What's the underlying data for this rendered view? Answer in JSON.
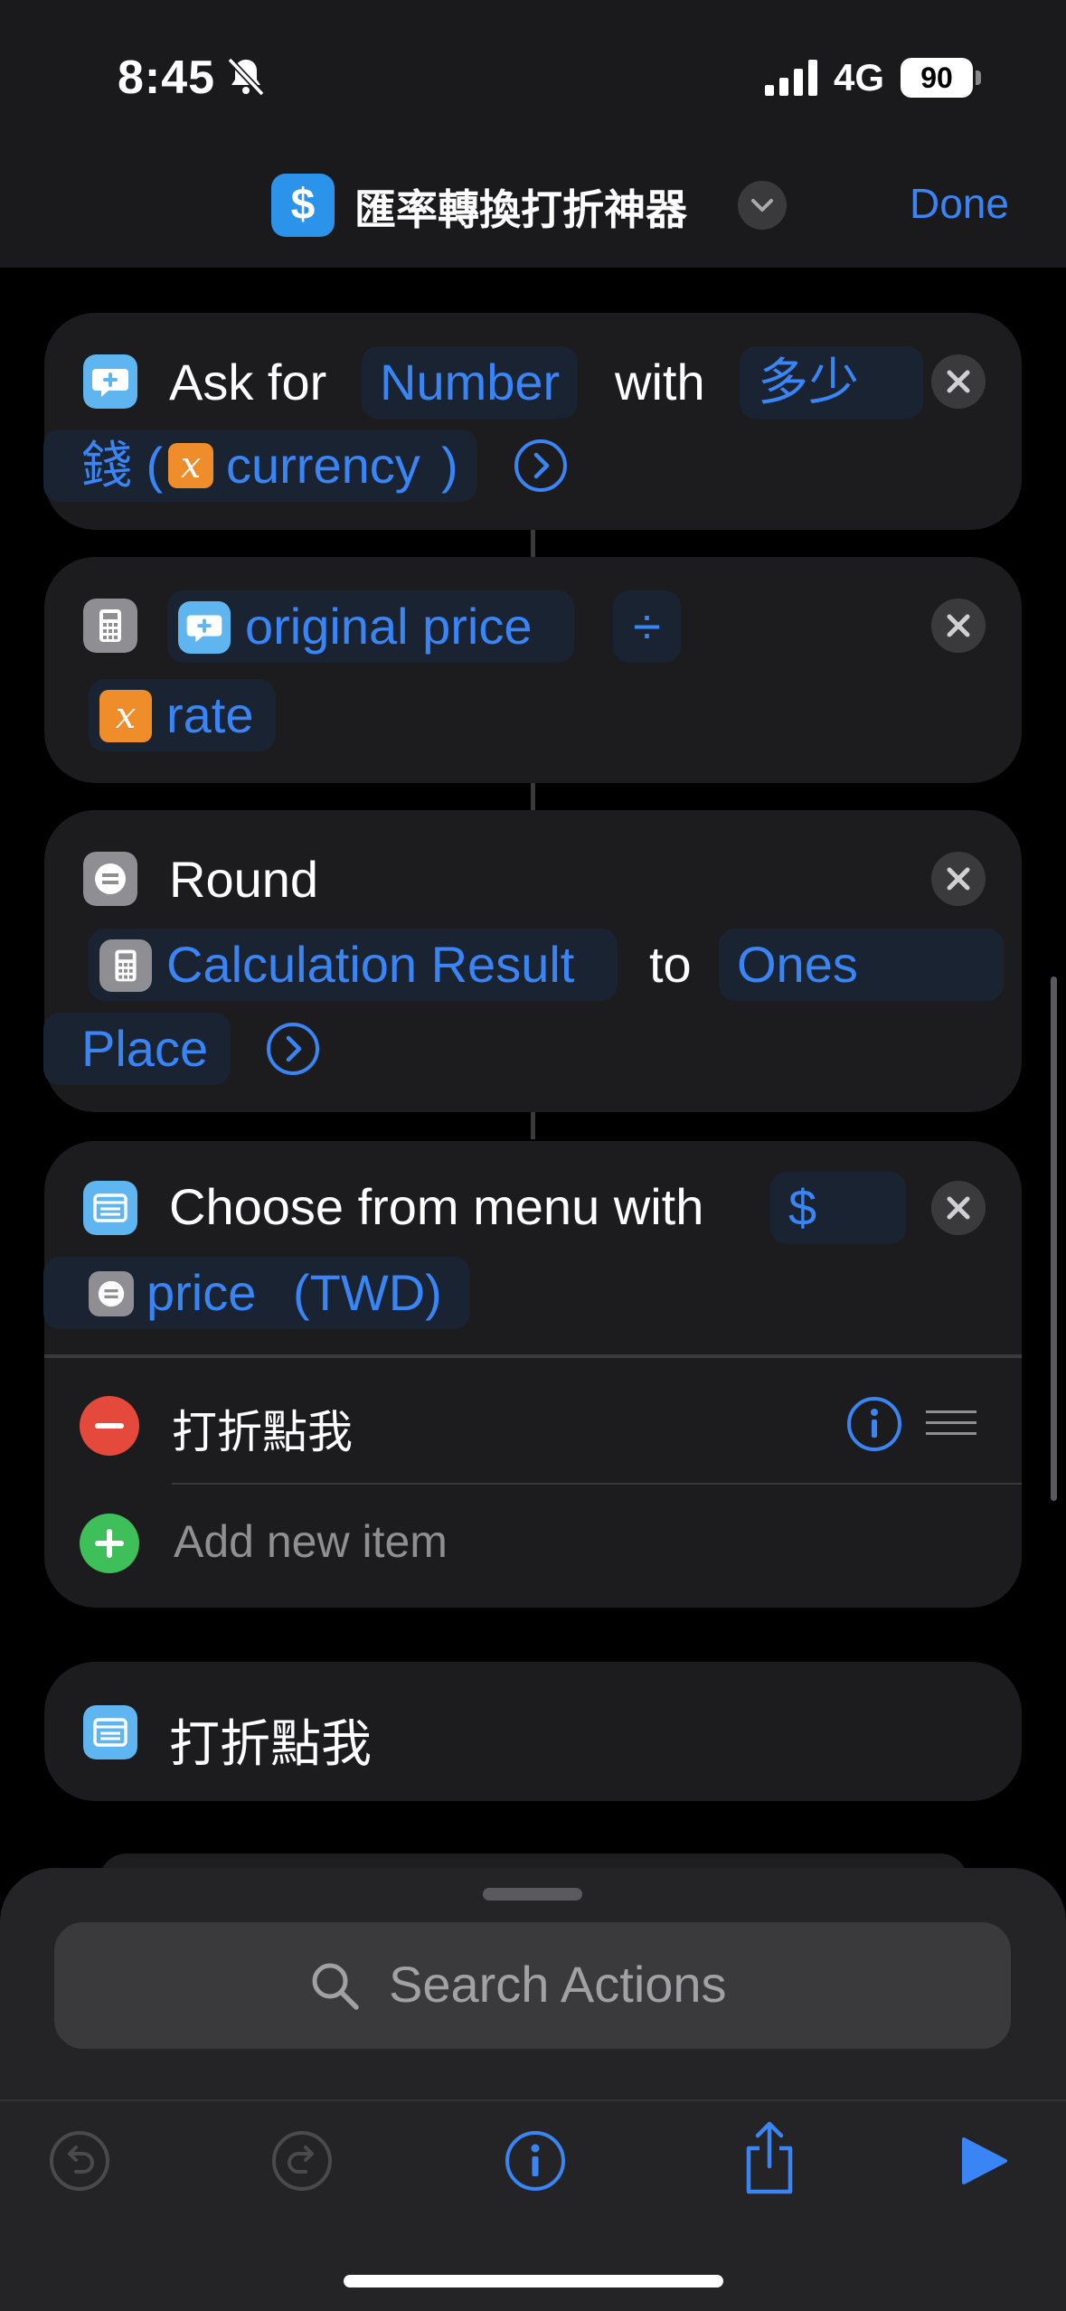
{
  "status": {
    "time": "8:45",
    "network": "4G",
    "battery": "90"
  },
  "nav": {
    "title": "匯率轉換打折神器",
    "done": "Done",
    "app_icon": "$"
  },
  "actions": {
    "ask": {
      "ask_for": "Ask for",
      "type": "Number",
      "with": "with",
      "prompt_a": "多少",
      "prompt_b": "錢 (",
      "var": "currency",
      "paren": ")"
    },
    "calc": {
      "operand1": "original price",
      "operator": "÷",
      "operand2": "rate"
    },
    "round": {
      "label": "Round",
      "input": "Calculation Result",
      "to": "to",
      "place_a": "Ones",
      "place_b": "Place"
    },
    "menu": {
      "label": "Choose from menu with",
      "prompt_a": "$",
      "prompt_var": "price",
      "prompt_b": "(TWD)",
      "items": [
        {
          "label": "打折點我"
        }
      ],
      "add_item": "Add new item"
    },
    "menu_case": {
      "label": "打折點我"
    }
  },
  "sheet": {
    "search_placeholder": "Search Actions"
  },
  "icons": [
    "bell-slash-icon",
    "signal-icon",
    "battery-icon",
    "chevron-down-icon",
    "ask-input-icon",
    "calculator-icon",
    "round-icon",
    "menu-icon",
    "variable-x-icon",
    "close-icon",
    "chevron-right-circle-icon",
    "remove-icon",
    "add-icon",
    "info-icon",
    "reorder-icon",
    "search-icon",
    "undo-icon",
    "redo-icon",
    "share-icon",
    "play-icon"
  ],
  "colors": {
    "accent": "#3a85f6",
    "card": "#1c1c1e",
    "variable": "#f08d2b",
    "remove": "#e5493c",
    "add": "#3fbf5a"
  }
}
